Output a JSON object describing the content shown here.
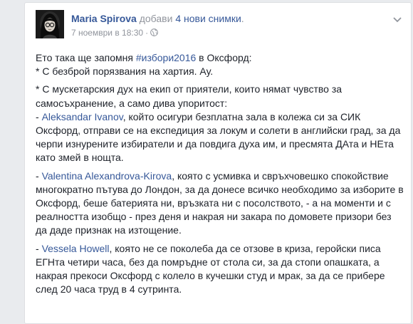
{
  "post": {
    "author": "Maria Spirova",
    "action": "добави",
    "photos_link": "4 нови снимки",
    "suffix": ".",
    "date": "7 ноември в 18:30",
    "dot": "·"
  },
  "icons": {
    "avatar": "profile-photo",
    "privacy": "globe-icon",
    "menu": "chevron-down-icon"
  },
  "colors": {
    "link": "#365899",
    "meta": "#90949c",
    "text": "#1d2129"
  },
  "body": {
    "p1_l1_a": "Ето така ще запомня ",
    "p1_hashtag": "#избори2016",
    "p1_l1_b": " в Оксфорд:",
    "p1_l2": "* С безброй порязвания на хартия. Ау.",
    "p2_l1": "* С мускетарския дух на екип от приятели, които нямат чувство за самосъхранение, а само дива упоритост:",
    "p2_dash": "- ",
    "p2_link": "Aleksandar Ivanov",
    "p2_rest": ", който осигури безплатна зала в колежа си за СИК Оксфорд, отправи се на експедиция за локум и солети в английски град, за да черпи изнурените избиратели и да повдига духа им, и пресмята ДАта и НЕта като змей в нощта.",
    "p3_dash": "- ",
    "p3_link": "Valentina Alexandrova-Kirova",
    "p3_rest": ", която с усмивка и свръхчовешко спокойствие многократно пътува до Лондон, за да донесе всичко необходимо за изборите в Оксфорд, беше батерията ни, връзката ни с посолството, - а на моменти и с реалността изобщо - през деня и накрая ни закара по домовете призори без да даде признак на изтощение.",
    "p4_dash": "- ",
    "p4_link": "Vessela Howell",
    "p4_rest": ", която не се поколеба да се отзове в криза, геройски писа ЕГНта четири часа, без да помръдне от стола си, за да стопи опашката, а накрая прекоси Оксфорд с колело в кучешки студ и мрак, за да се прибере след 20 часа труд в 4 сутринта."
  }
}
